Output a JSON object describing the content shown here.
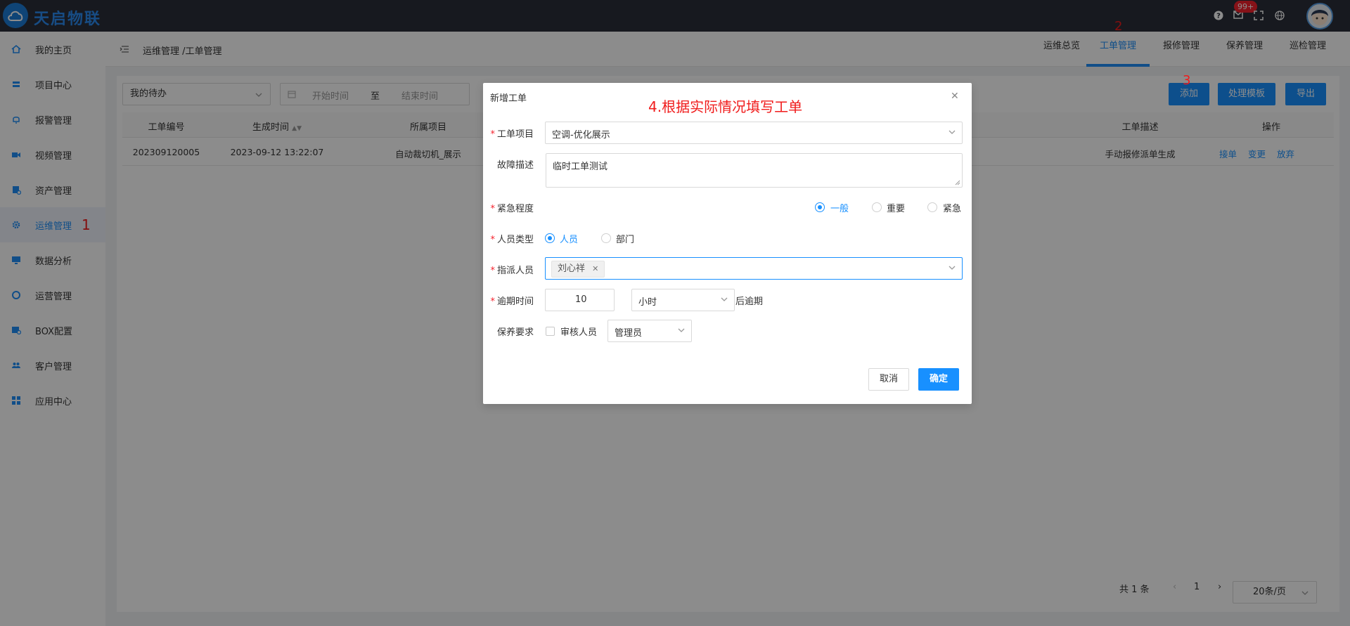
{
  "topbar": {
    "brand": "天启物联",
    "notification_badge": "99+"
  },
  "sidebar": {
    "items": [
      {
        "label": "我的主页",
        "icon": "home-icon"
      },
      {
        "label": "项目中心",
        "icon": "stack-icon"
      },
      {
        "label": "报警管理",
        "icon": "bell-icon"
      },
      {
        "label": "视频管理",
        "icon": "video-icon"
      },
      {
        "label": "资产管理",
        "icon": "asset-icon"
      },
      {
        "label": "运维管理",
        "icon": "gear-icon",
        "active": true
      },
      {
        "label": "数据分析",
        "icon": "monitor-icon"
      },
      {
        "label": "运营管理",
        "icon": "shield-icon"
      },
      {
        "label": "BOX配置",
        "icon": "box-config-icon"
      },
      {
        "label": "客户管理",
        "icon": "users-icon"
      },
      {
        "label": "应用中心",
        "icon": "grid-icon"
      }
    ]
  },
  "header": {
    "breadcrumb": "运维管理 /工单管理",
    "tabs": [
      "运维总览",
      "工单管理",
      "报修管理",
      "保养管理",
      "巡检管理"
    ],
    "active_tab": "工单管理"
  },
  "toolbar": {
    "filter_value": "我的待办",
    "start_placeholder": "开始时间",
    "range_separator": "至",
    "end_placeholder": "结束时间",
    "add_label": "添加",
    "template_label": "处理模板",
    "export_label": "导出"
  },
  "table": {
    "headers": [
      "工单编号",
      "生成时间",
      "所属项目",
      "工单描述",
      "操作"
    ],
    "rows": [
      {
        "id": "202309120005",
        "time": "2023-09-12 13:22:07",
        "project": "自动裁切机_展示",
        "desc": "手动报修派单生成",
        "actions": [
          "接单",
          "变更",
          "放弃"
        ]
      }
    ]
  },
  "pagination": {
    "total": "共 1 条",
    "page": "1",
    "page_size": "20条/页"
  },
  "modal": {
    "title": "新增工单",
    "fields": {
      "project_label": "工单项目",
      "project_value": "空调-优化展示",
      "fault_label": "故障描述",
      "fault_value": "临时工单测试",
      "urgency_label": "紧急程度",
      "urgency_options": [
        "一般",
        "重要",
        "紧急"
      ],
      "urgency_selected": "一般",
      "person_type_label": "人员类型",
      "person_type_options": [
        "人员",
        "部门"
      ],
      "person_type_selected": "人员",
      "assignee_label": "指派人员",
      "assignee_tag": "刘心祥",
      "overdue_label": "逾期时间",
      "overdue_value": "10",
      "overdue_unit": "小时",
      "overdue_suffix": "后逾期",
      "maintenance_label": "保养要求",
      "reviewer_label": "审核人员",
      "reviewer_value": "管理员"
    },
    "cancel_label": "取消",
    "ok_label": "确定"
  },
  "annotations": {
    "step1": "1",
    "step2": "2",
    "step3": "3",
    "step4": "4.根据实际情况填写工单"
  },
  "colors": {
    "primary": "#1890ff",
    "topbar": "#2b2f3a",
    "annotation": "#f01b1b"
  }
}
